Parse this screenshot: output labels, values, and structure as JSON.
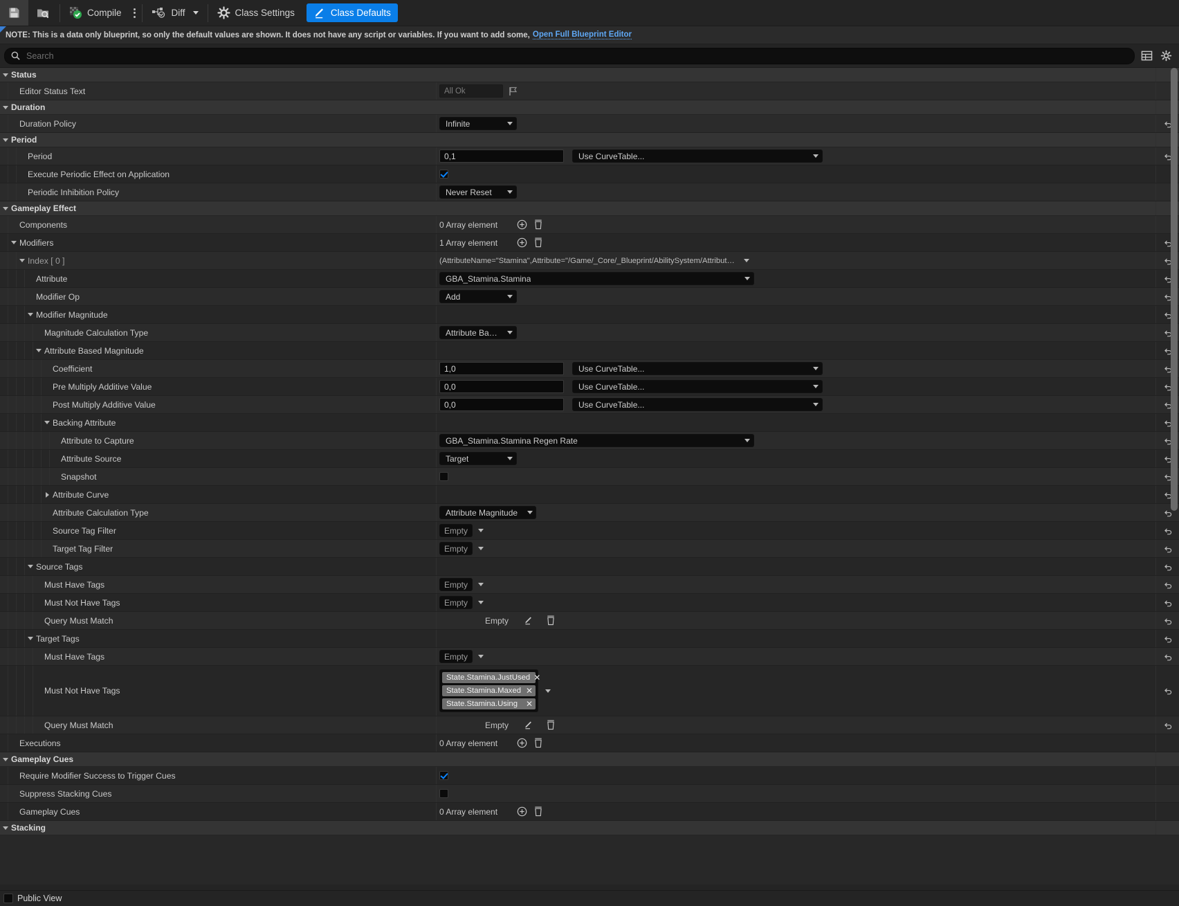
{
  "toolbar": {
    "save_label": "",
    "browse_label": "",
    "compile_label": "Compile",
    "diff_label": "Diff",
    "class_settings_label": "Class Settings",
    "class_defaults_label": "Class Defaults",
    "accent_color": "#0a7ee8"
  },
  "note": {
    "text": "NOTE: This is a data only blueprint, so only the default values are shown.  It does not have any script or variables.  If you want to add some,",
    "link": "Open Full Blueprint Editor"
  },
  "search": {
    "placeholder": "Search",
    "value": ""
  },
  "footer": {
    "label": "Public View"
  },
  "values": {
    "all_ok": "All Ok",
    "infinite": "Infinite",
    "period": "0,1",
    "use_curve_table": "Use CurveTable...",
    "never_reset": "Never Reset",
    "zero_array": "0 Array element",
    "one_array": "1 Array element",
    "modifier_struct": "(AttributeName=\"Stamina\",Attribute=\"/Game/_Core/_Blueprint/AbilitySystem/Attributes/St",
    "gba_stamina": "GBA_Stamina.Stamina",
    "add": "Add",
    "attribute_based": "Attribute Based",
    "coefficient": "1,0",
    "pre_multiply": "0,0",
    "post_multiply": "0,0",
    "regen_rate": "GBA_Stamina.Stamina Regen Rate",
    "target": "Target",
    "attribute_magnitude": "Attribute Magnitude",
    "empty": "Empty"
  },
  "tags": [
    "State.Stamina.JustUsed",
    "State.Stamina.Maxed",
    "State.Stamina.Using"
  ],
  "rows": [
    {
      "kind": "cat",
      "label": "Status",
      "indent": 0
    },
    {
      "kind": "prop",
      "label": "Editor Status Text",
      "indent": 0,
      "widget": "statustext"
    },
    {
      "kind": "cat",
      "label": "Duration",
      "indent": 0
    },
    {
      "kind": "prop",
      "label": "Duration Policy",
      "indent": 0,
      "widget": "combo_small",
      "value": "Infinite",
      "revert": true
    },
    {
      "kind": "cat",
      "label": "Period",
      "indent": 0
    },
    {
      "kind": "prop",
      "label": "Period",
      "indent": 1,
      "widget": "num_curve",
      "value": "0,1",
      "curve": "Use CurveTable...",
      "revert": true
    },
    {
      "kind": "prop",
      "label": "Execute Periodic Effect on Application",
      "indent": 1,
      "widget": "checkbox_on"
    },
    {
      "kind": "prop",
      "label": "Periodic Inhibition Policy",
      "indent": 1,
      "widget": "combo_small",
      "value": "Never Reset"
    },
    {
      "kind": "cat",
      "label": "Gameplay Effect",
      "indent": 0
    },
    {
      "kind": "prop",
      "label": "Components",
      "indent": 0,
      "widget": "array",
      "value": "0 Array element"
    },
    {
      "kind": "prop",
      "label": "Modifiers",
      "indent": 0,
      "widget": "array",
      "value": "1 Array element",
      "twisty": "down",
      "revert": true
    },
    {
      "kind": "prop",
      "label": "Index [ 0 ]",
      "indent": 1,
      "widget": "struct",
      "twisty": "down",
      "dim": true,
      "revert": true
    },
    {
      "kind": "prop",
      "label": "Attribute",
      "indent": 2,
      "widget": "combo_wide",
      "value": "GBA_Stamina.Stamina",
      "revert": true
    },
    {
      "kind": "prop",
      "label": "Modifier Op",
      "indent": 2,
      "widget": "combo_small",
      "value": "Add",
      "revert": true
    },
    {
      "kind": "prop",
      "label": "Modifier Magnitude",
      "indent": 2,
      "widget": "none",
      "twisty": "down",
      "revert": true
    },
    {
      "kind": "prop",
      "label": "Magnitude Calculation Type",
      "indent": 3,
      "widget": "combo_small",
      "value": "Attribute Based",
      "revert": true
    },
    {
      "kind": "prop",
      "label": "Attribute Based Magnitude",
      "indent": 3,
      "widget": "none",
      "twisty": "down",
      "revert": true
    },
    {
      "kind": "prop",
      "label": "Coefficient",
      "indent": 4,
      "widget": "num_curve",
      "value": "1,0",
      "curve": "Use CurveTable...",
      "revert": true
    },
    {
      "kind": "prop",
      "label": "Pre Multiply Additive Value",
      "indent": 4,
      "widget": "num_curve",
      "value": "0,0",
      "curve": "Use CurveTable...",
      "revert": true
    },
    {
      "kind": "prop",
      "label": "Post Multiply Additive Value",
      "indent": 4,
      "widget": "num_curve",
      "value": "0,0",
      "curve": "Use CurveTable...",
      "revert": true
    },
    {
      "kind": "prop",
      "label": "Backing Attribute",
      "indent": 4,
      "widget": "none",
      "twisty": "down",
      "revert": true
    },
    {
      "kind": "prop",
      "label": "Attribute to Capture",
      "indent": 5,
      "widget": "combo_wide",
      "value": "GBA_Stamina.Stamina Regen Rate",
      "revert": true
    },
    {
      "kind": "prop",
      "label": "Attribute Source",
      "indent": 5,
      "widget": "combo_small",
      "value": "Target",
      "revert": true
    },
    {
      "kind": "prop",
      "label": "Snapshot",
      "indent": 5,
      "widget": "checkbox_off",
      "revert": true
    },
    {
      "kind": "prop",
      "label": "Attribute Curve",
      "indent": 4,
      "widget": "none",
      "twisty": "right",
      "revert": true
    },
    {
      "kind": "prop",
      "label": "Attribute Calculation Type",
      "indent": 4,
      "widget": "combo_auto",
      "value": "Attribute Magnitude",
      "revert": true
    },
    {
      "kind": "prop",
      "label": "Source Tag Filter",
      "indent": 4,
      "widget": "tag_empty",
      "value": "Empty",
      "revert": true
    },
    {
      "kind": "prop",
      "label": "Target Tag Filter",
      "indent": 4,
      "widget": "tag_empty",
      "value": "Empty",
      "revert": true
    },
    {
      "kind": "prop",
      "label": "Source Tags",
      "indent": 2,
      "widget": "none",
      "twisty": "down",
      "revert": true
    },
    {
      "kind": "prop",
      "label": "Must Have Tags",
      "indent": 3,
      "widget": "tag_empty",
      "value": "Empty",
      "revert": true
    },
    {
      "kind": "prop",
      "label": "Must Not Have Tags",
      "indent": 3,
      "widget": "tag_empty",
      "value": "Empty",
      "revert": true
    },
    {
      "kind": "prop",
      "label": "Query Must Match",
      "indent": 3,
      "widget": "query",
      "value": "Empty",
      "revert": true
    },
    {
      "kind": "prop",
      "label": "Target Tags",
      "indent": 2,
      "widget": "none",
      "twisty": "down",
      "revert": true
    },
    {
      "kind": "prop",
      "label": "Must Have Tags",
      "indent": 3,
      "widget": "tag_empty",
      "value": "Empty",
      "revert": true
    },
    {
      "kind": "prop",
      "label": "Must Not Have Tags",
      "indent": 3,
      "widget": "tag_chips",
      "revert": true
    },
    {
      "kind": "prop",
      "label": "Query Must Match",
      "indent": 3,
      "widget": "query",
      "value": "Empty",
      "revert": true
    },
    {
      "kind": "prop",
      "label": "Executions",
      "indent": 0,
      "widget": "array",
      "value": "0 Array element"
    },
    {
      "kind": "cat",
      "label": "Gameplay Cues",
      "indent": 0
    },
    {
      "kind": "prop",
      "label": "Require Modifier Success to Trigger Cues",
      "indent": 0,
      "widget": "checkbox_on"
    },
    {
      "kind": "prop",
      "label": "Suppress Stacking Cues",
      "indent": 0,
      "widget": "checkbox_off"
    },
    {
      "kind": "prop",
      "label": "Gameplay Cues",
      "indent": 0,
      "widget": "array",
      "value": "0 Array element"
    },
    {
      "kind": "cat",
      "label": "Stacking",
      "indent": 0
    }
  ]
}
